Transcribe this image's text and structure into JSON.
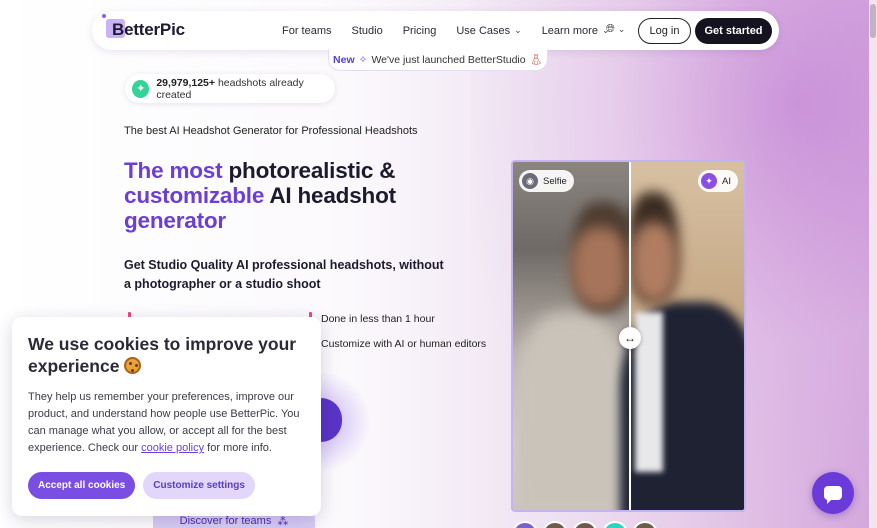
{
  "nav": {
    "logo": "BetterPic",
    "links": [
      {
        "label": "For teams",
        "dropdown": false
      },
      {
        "label": "Studio",
        "dropdown": false
      },
      {
        "label": "Pricing",
        "dropdown": false
      },
      {
        "label": "Use Cases",
        "dropdown": true
      },
      {
        "label": "Learn more",
        "dropdown": true
      }
    ],
    "login": "Log in",
    "get_started": "Get started"
  },
  "announcement": {
    "new_label": "New",
    "text": "We've just launched BetterStudio"
  },
  "counter": {
    "count": "29,979,125+",
    "text": "headshots already created"
  },
  "hero": {
    "subtitle": "The best AI Headshot Generator for Professional Headshots",
    "title_purple_1": "The most",
    "title_dark_1": "photorealistic &",
    "title_purple_2": "customizable",
    "title_dark_2": "AI headshot",
    "title_purple_3": "generator",
    "description": "Get Studio Quality AI professional headshots, without a photographer or a studio shoot",
    "features": [
      "Done in less than 1 hour",
      "Customize with AI or human editors"
    ],
    "discover": "Discover for teams"
  },
  "cookie": {
    "title": "We use cookies to improve your experience",
    "body_before": "They help us remember your preferences, improve our product, and understand how people use BetterPic. You can manage what you allow, or accept all for the best experience. Check our",
    "link": "cookie policy",
    "body_after": "for more info.",
    "accept": "Accept all cookies",
    "customize": "Customize settings"
  },
  "compare": {
    "selfie_label": "Selfie",
    "ai_label": "AI"
  },
  "colors": {
    "accent": "#6b3fd6",
    "dark": "#15131f"
  }
}
